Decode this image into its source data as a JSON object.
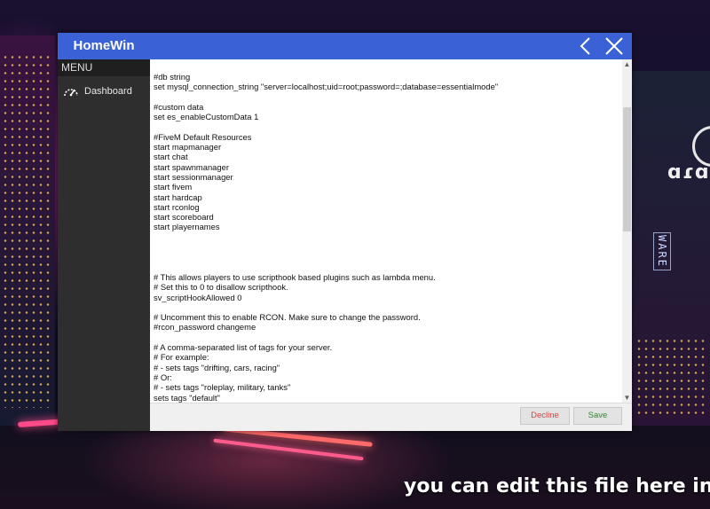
{
  "app": {
    "title": "HomeWin"
  },
  "sidebar": {
    "menu_header": "MENU",
    "items": [
      {
        "label": "Dashboard",
        "icon": "speedometer-icon"
      }
    ]
  },
  "titlebar": {
    "back_icon": "chevron-left-icon",
    "close_icon": "close-icon"
  },
  "editor": {
    "text": "#db string\nset mysql_connection_string \"server=localhost;uid=root;password=;database=essentialmode\"\n\n#custom data\nset es_enableCustomData 1\n\n#FiveM Default Resources\nstart mapmanager\nstart chat\nstart spawnmanager\nstart sessionmanager\nstart fivem\nstart hardcap\nstart rconlog\nstart scoreboard\nstart playernames\n\n\n\n\n# This allows players to use scripthook based plugins such as lambda menu.\n# Set this to 0 to disallow scripthook.\nsv_scriptHookAllowed 0\n\n# Uncomment this to enable RCON. Make sure to change the password.\n#rcon_password changeme\n\n# A comma-separated list of tags for your server.\n# For example:\n# - sets tags \"drifting, cars, racing\"\n# Or:\n# - sets tags \"roleplay, military, tanks\"\nsets tags \"default\""
  },
  "buttons": {
    "decline": "Decline",
    "save": "Save"
  },
  "caption": "you can edit this file here in",
  "colors": {
    "titlebar": "#3a62d6",
    "sidebar": "#2e2e2e",
    "decline_text": "#d84040",
    "save_text": "#2d8a2d"
  }
}
